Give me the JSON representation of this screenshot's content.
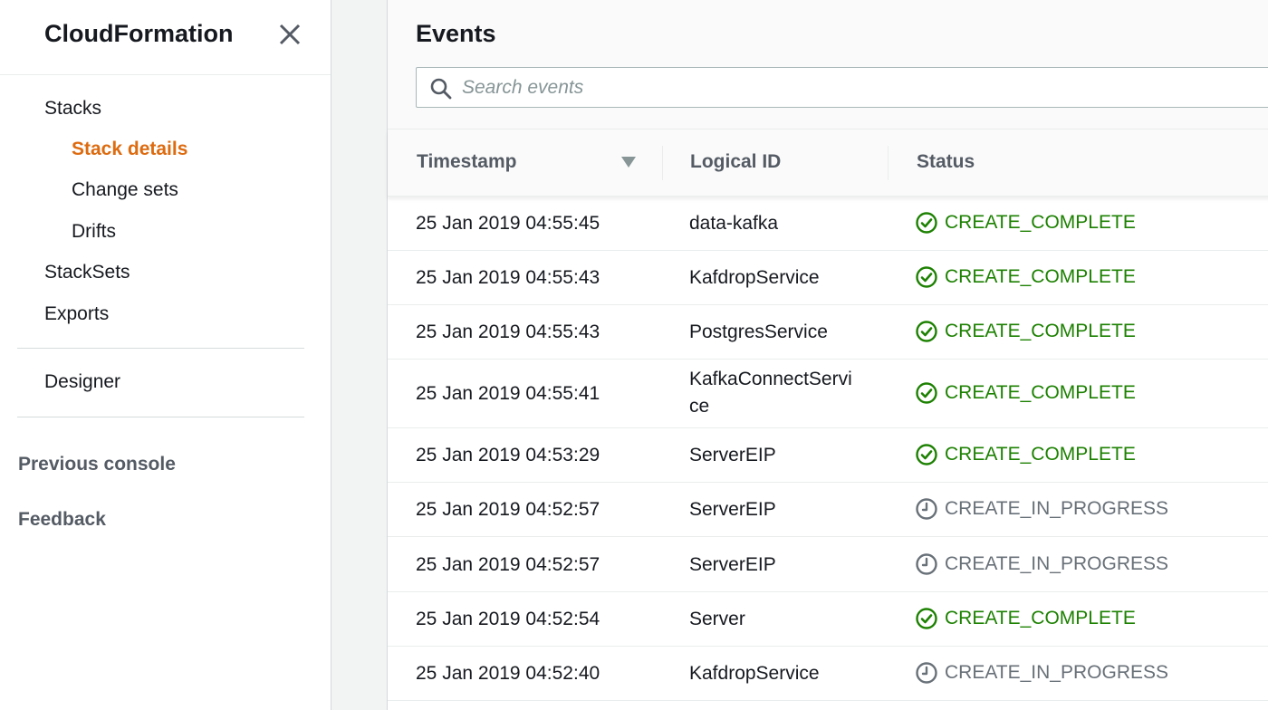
{
  "sidebar": {
    "title": "CloudFormation",
    "nav": {
      "stacks": "Stacks",
      "stack_details": "Stack details",
      "change_sets": "Change sets",
      "drifts": "Drifts",
      "stacksets": "StackSets",
      "exports": "Exports",
      "designer": "Designer",
      "previous_console": "Previous console",
      "feedback": "Feedback"
    }
  },
  "events": {
    "title": "Events",
    "search_placeholder": "Search events",
    "columns": {
      "timestamp": "Timestamp",
      "logical_id": "Logical ID",
      "status": "Status"
    },
    "rows": [
      {
        "timestamp": "25 Jan 2019 04:55:45",
        "logical_id": "data-kafka",
        "status": "CREATE_COMPLETE"
      },
      {
        "timestamp": "25 Jan 2019 04:55:43",
        "logical_id": "KafdropService",
        "status": "CREATE_COMPLETE"
      },
      {
        "timestamp": "25 Jan 2019 04:55:43",
        "logical_id": "PostgresService",
        "status": "CREATE_COMPLETE"
      },
      {
        "timestamp": "25 Jan 2019 04:55:41",
        "logical_id": "KafkaConnectServi ce",
        "status": "CREATE_COMPLETE"
      },
      {
        "timestamp": "25 Jan 2019 04:53:29",
        "logical_id": "ServerEIP",
        "status": "CREATE_COMPLETE"
      },
      {
        "timestamp": "25 Jan 2019 04:52:57",
        "logical_id": "ServerEIP",
        "status": "CREATE_IN_PROGRESS"
      },
      {
        "timestamp": "25 Jan 2019 04:52:57",
        "logical_id": "ServerEIP",
        "status": "CREATE_IN_PROGRESS"
      },
      {
        "timestamp": "25 Jan 2019 04:52:54",
        "logical_id": "Server",
        "status": "CREATE_COMPLETE"
      },
      {
        "timestamp": "25 Jan 2019 04:52:40",
        "logical_id": "KafdropService",
        "status": "CREATE_IN_PROGRESS"
      }
    ]
  },
  "icons": {
    "close": "close-icon",
    "search": "search-icon",
    "sort": "sort-descending-icon",
    "complete": "check-circle-icon",
    "in_progress": "clock-icon"
  },
  "colors": {
    "accent": "#dd6b10",
    "success": "#1d8102",
    "in_progress": "#687078"
  }
}
